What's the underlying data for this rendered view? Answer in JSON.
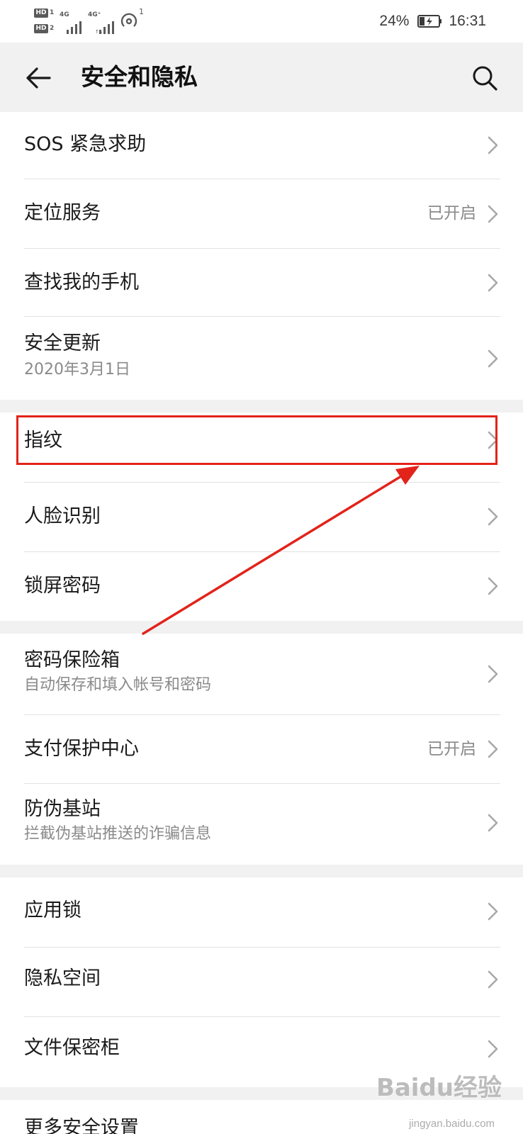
{
  "status_bar": {
    "hd1": "HD",
    "hd1_num": "1",
    "hd2": "HD",
    "hd2_num": "2",
    "sig1_tag": "4G",
    "sig2_tag": "4G⁺",
    "wifi_sup": "1",
    "battery_pct": "24%",
    "time": "16:31"
  },
  "header": {
    "title": "安全和隐私"
  },
  "icons": {
    "back": "back-arrow-icon",
    "search": "search-icon",
    "chevron": "chevron-right-icon"
  },
  "colors": {
    "highlight": "#e2231a",
    "background": "#f1f1f1",
    "card": "#ffffff"
  },
  "groups": [
    {
      "items": [
        {
          "title": "SOS 紧急求助",
          "subtitle": "",
          "value": ""
        },
        {
          "title": "定位服务",
          "subtitle": "",
          "value": "已开启"
        },
        {
          "title": "查找我的手机",
          "subtitle": "",
          "value": ""
        },
        {
          "title": "安全更新",
          "subtitle": "2020年3月1日",
          "value": ""
        }
      ]
    },
    {
      "items": [
        {
          "title": "指纹",
          "subtitle": "",
          "value": ""
        },
        {
          "title": "人脸识别",
          "subtitle": "",
          "value": ""
        },
        {
          "title": "锁屏密码",
          "subtitle": "",
          "value": ""
        }
      ]
    },
    {
      "items": [
        {
          "title": "密码保险箱",
          "subtitle": "自动保存和填入帐号和密码",
          "value": ""
        },
        {
          "title": "支付保护中心",
          "subtitle": "",
          "value": "已开启"
        },
        {
          "title": "防伪基站",
          "subtitle": "拦截伪基站推送的诈骗信息",
          "value": ""
        }
      ]
    },
    {
      "items": [
        {
          "title": "应用锁",
          "subtitle": "",
          "value": ""
        },
        {
          "title": "隐私空间",
          "subtitle": "",
          "value": ""
        },
        {
          "title": "文件保密柜",
          "subtitle": "",
          "value": ""
        }
      ]
    },
    {
      "items": [
        {
          "title": "更多安全设置",
          "subtitle": "",
          "value": ""
        }
      ]
    }
  ],
  "watermark": {
    "brand": "Baidu经验",
    "url": "jingyan.baidu.com"
  }
}
